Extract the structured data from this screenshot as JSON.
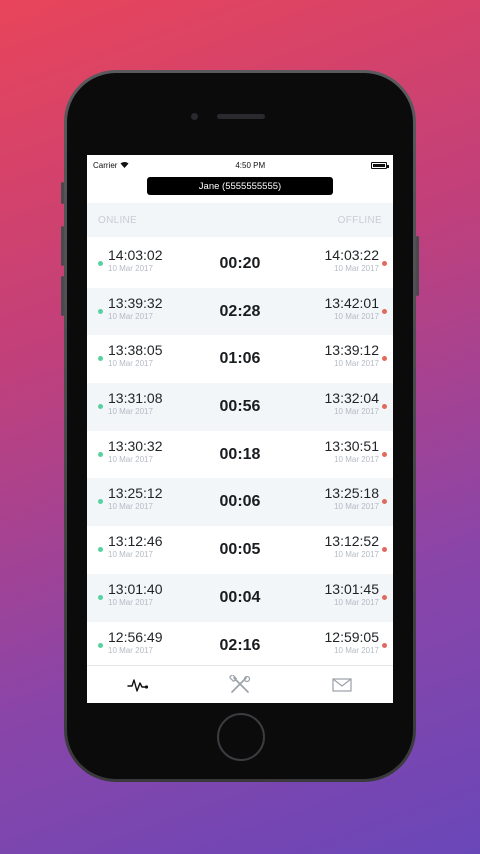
{
  "status_bar": {
    "carrier": "Carrier",
    "time": "4:50 PM"
  },
  "header": {
    "title": "Jane (5555555555)"
  },
  "columns": {
    "online": "ONLINE",
    "offline": "OFFLINE"
  },
  "rows": [
    {
      "online_time": "14:03:02",
      "online_date": "10 Mar 2017",
      "duration": "00:20",
      "offline_time": "14:03:22",
      "offline_date": "10 Mar 2017"
    },
    {
      "online_time": "13:39:32",
      "online_date": "10 Mar 2017",
      "duration": "02:28",
      "offline_time": "13:42:01",
      "offline_date": "10 Mar 2017"
    },
    {
      "online_time": "13:38:05",
      "online_date": "10 Mar 2017",
      "duration": "01:06",
      "offline_time": "13:39:12",
      "offline_date": "10 Mar 2017"
    },
    {
      "online_time": "13:31:08",
      "online_date": "10 Mar 2017",
      "duration": "00:56",
      "offline_time": "13:32:04",
      "offline_date": "10 Mar 2017"
    },
    {
      "online_time": "13:30:32",
      "online_date": "10 Mar 2017",
      "duration": "00:18",
      "offline_time": "13:30:51",
      "offline_date": "10 Mar 2017"
    },
    {
      "online_time": "13:25:12",
      "online_date": "10 Mar 2017",
      "duration": "00:06",
      "offline_time": "13:25:18",
      "offline_date": "10 Mar 2017"
    },
    {
      "online_time": "13:12:46",
      "online_date": "10 Mar 2017",
      "duration": "00:05",
      "offline_time": "13:12:52",
      "offline_date": "10 Mar 2017"
    },
    {
      "online_time": "13:01:40",
      "online_date": "10 Mar 2017",
      "duration": "00:04",
      "offline_time": "13:01:45",
      "offline_date": "10 Mar 2017"
    },
    {
      "online_time": "12:56:49",
      "online_date": "10 Mar 2017",
      "duration": "02:16",
      "offline_time": "12:59:05",
      "offline_date": "10 Mar 2017"
    }
  ],
  "tabs": [
    {
      "icon": "activity-icon",
      "active": true
    },
    {
      "icon": "tools-icon",
      "active": false
    },
    {
      "icon": "mail-icon",
      "active": false
    }
  ],
  "colors": {
    "online_dot": "#56d1a0",
    "offline_dot": "#e06a5e",
    "header_bg": "#000000"
  }
}
